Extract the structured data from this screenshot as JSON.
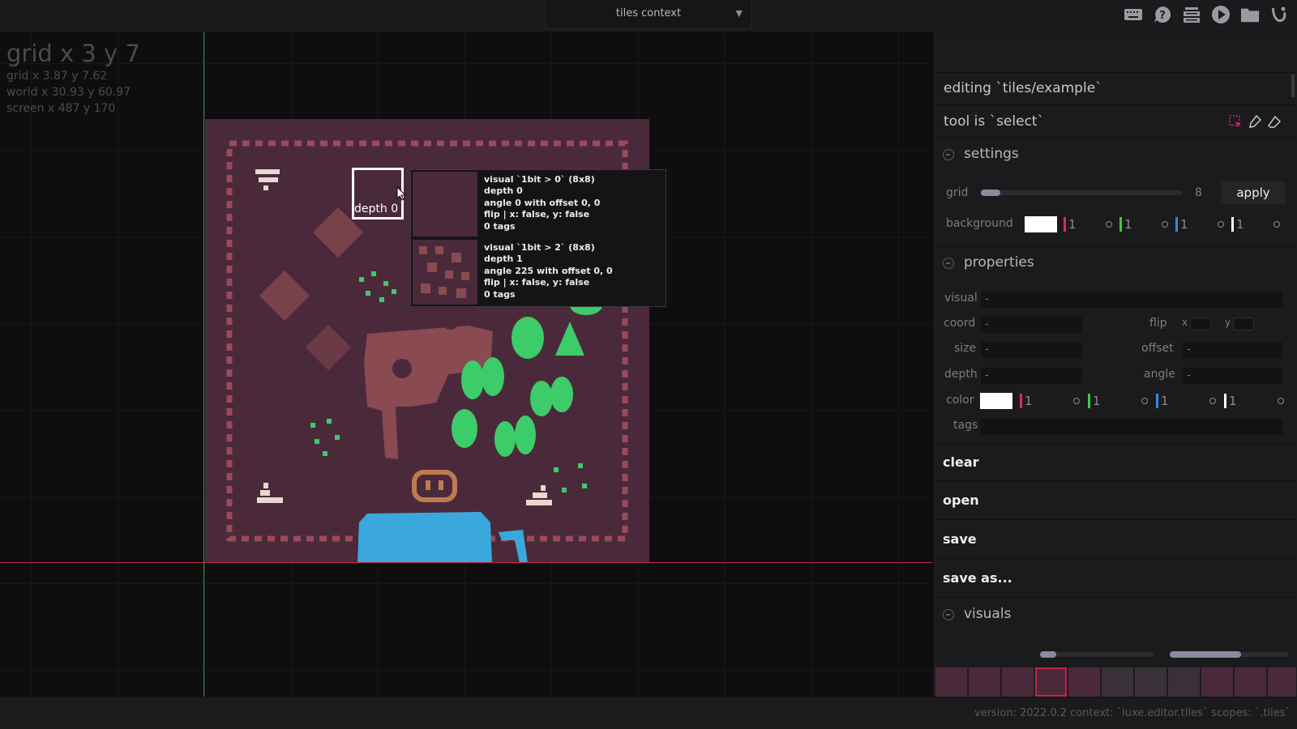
{
  "context_select": {
    "label": "tiles context"
  },
  "toolbar_icons": [
    "keyboard-icon",
    "help-icon",
    "stack-icon",
    "play-icon",
    "folder-icon",
    "luxe-logo-icon"
  ],
  "coords": {
    "grid_big": "grid x 3 y 7",
    "grid": "grid x 3.87 y 7.62",
    "world": "world x 30.93 y 60.97",
    "screen": "screen x 487 y 170"
  },
  "selection_label": "depth 0",
  "tooltip": [
    {
      "visual": "visual `1bit > 0` (8x8)",
      "depth": "depth 0",
      "angle": "angle 0 with offset 0, 0",
      "flip": "flip | x: false, y: false",
      "tags": "0 tags"
    },
    {
      "visual": "visual `1bit > 2` (8x8)",
      "depth": "depth 1",
      "angle": "angle 225 with offset 0, 0",
      "flip": "flip | x: false, y: false",
      "tags": "0 tags"
    }
  ],
  "panel": {
    "editing": "editing `tiles/example`",
    "tool": "tool is `select`",
    "tool_icons": [
      "select-tool-icon",
      "paint-brush-icon",
      "eraser-icon"
    ],
    "settings": {
      "header": "settings",
      "grid_label": "grid",
      "grid_value": "8",
      "grid_fraction": 0.04,
      "apply": "apply",
      "background_label": "background",
      "background_channels": [
        "1",
        "1",
        "1",
        "1"
      ]
    },
    "properties": {
      "header": "properties",
      "visual_label": "visual",
      "visual_value": "-",
      "coord_label": "coord",
      "coord_value": "-",
      "flip_label": "flip",
      "flip_x": "x",
      "flip_y": "y",
      "size_label": "size",
      "size_value": "-",
      "offset_label": "offset",
      "offset_value": "-",
      "depth_label": "depth",
      "depth_value": "-",
      "angle_label": "angle",
      "angle_value": "-",
      "color_label": "color",
      "color_channels": [
        "1",
        "1",
        "1",
        "1"
      ],
      "tags_label": "tags"
    },
    "actions": [
      "clear",
      "open",
      "save",
      "save as..."
    ],
    "visuals": {
      "header": "visuals"
    }
  },
  "colors": {
    "map_bg": "#4a2a3a",
    "border_tile": "#9a4a5a",
    "dirt": "#8a4a52",
    "tree": "#3ccc6a",
    "water": "#3aa8dc",
    "bricks": "#e8d8d0",
    "red": "#e02c4a",
    "green": "#3ccc3c",
    "blue": "#2c8ce0",
    "white": "#ffffff"
  },
  "status": "version: 2022.0.2 context: `luxe.editor.tiles` scopes: `.tiles`"
}
